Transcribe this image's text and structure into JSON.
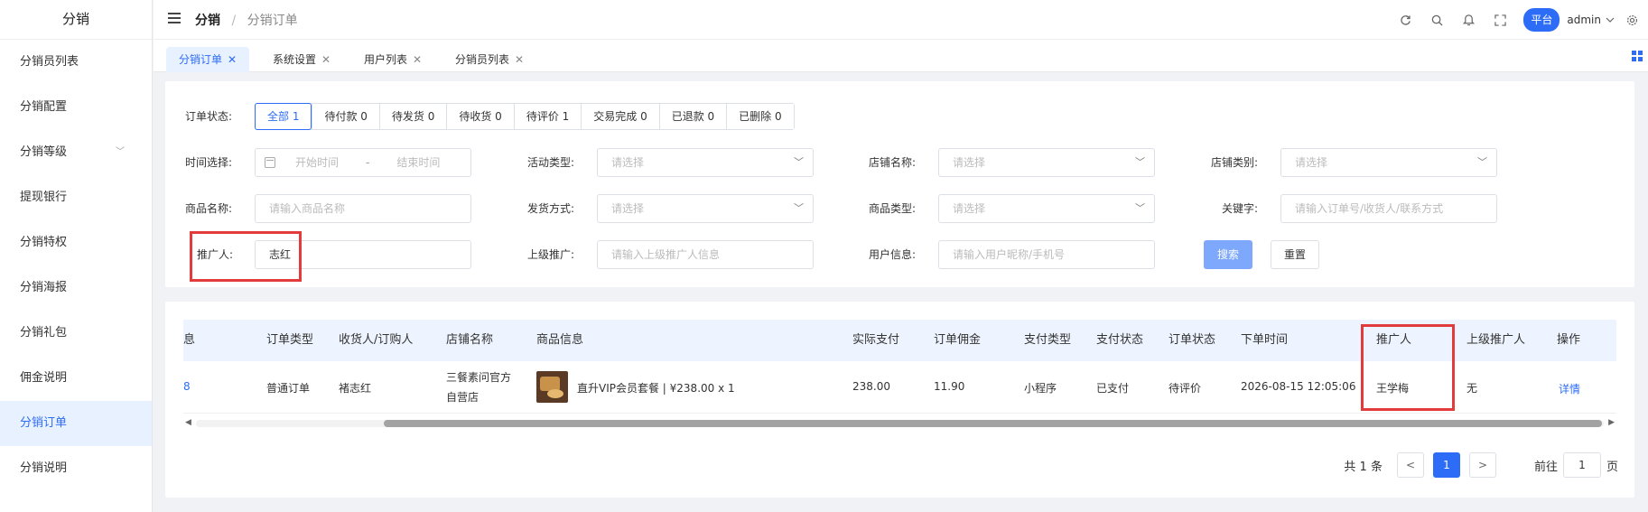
{
  "sidebar": {
    "title": "分销",
    "items": [
      {
        "label": "分销员列表"
      },
      {
        "label": "分销配置"
      },
      {
        "label": "分销等级"
      },
      {
        "label": "提现银行"
      },
      {
        "label": "分销特权"
      },
      {
        "label": "分销海报"
      },
      {
        "label": "分销礼包"
      },
      {
        "label": "佣金说明"
      },
      {
        "label": "分销订单"
      },
      {
        "label": "分销说明"
      }
    ],
    "active": "分销订单"
  },
  "header": {
    "breadcrumb_root": "分销",
    "breadcrumb_sep": "/",
    "breadcrumb_current": "分销订单",
    "platform_badge": "平台",
    "user": "admin",
    "icons": [
      "refresh-icon",
      "search-icon",
      "bell-icon",
      "fullscreen-icon",
      "chevron-down-icon",
      "settings-icon"
    ]
  },
  "tabs": [
    {
      "label": "分销订单",
      "active": true
    },
    {
      "label": "系统设置",
      "active": false
    },
    {
      "label": "用户列表",
      "active": false
    },
    {
      "label": "分销员列表",
      "active": false
    }
  ],
  "filters": {
    "order_status_label": "订单状态:",
    "statuses": [
      {
        "label": "全部 1"
      },
      {
        "label": "待付款 0"
      },
      {
        "label": "待发货 0"
      },
      {
        "label": "待收货 0"
      },
      {
        "label": "待评价 1"
      },
      {
        "label": "交易完成 0"
      },
      {
        "label": "已退款 0"
      },
      {
        "label": "已删除 0"
      }
    ],
    "time_label": "时间选择:",
    "time_start_placeholder": "开始时间",
    "time_sep": "-",
    "time_end_placeholder": "结束时间",
    "activity_label": "活动类型:",
    "activity_placeholder": "请选择",
    "shop_name_label": "店铺名称:",
    "shop_name_placeholder": "请选择",
    "shop_type_label": "店铺类别:",
    "shop_type_placeholder": "请选择",
    "product_name_label": "商品名称:",
    "product_name_placeholder": "请输入商品名称",
    "ship_label": "发货方式:",
    "ship_placeholder": "请选择",
    "product_type_label": "商品类型:",
    "product_type_placeholder": "请选择",
    "keyword_label": "关键字:",
    "keyword_placeholder": "请输入订单号/收货人/联系方式",
    "promoter_label": "推广人:",
    "promoter_value": "志红",
    "parent_label": "上级推广:",
    "parent_placeholder": "请输入上级推广人信息",
    "user_label": "用户信息:",
    "user_placeholder": "请输入用户昵称/手机号",
    "search_btn": "搜索",
    "reset_btn": "重置"
  },
  "table": {
    "columns": [
      "息",
      "订单类型",
      "收货人/订购人",
      "店铺名称",
      "商品信息",
      "实际支付",
      "订单佣金",
      "支付类型",
      "支付状态",
      "订单状态",
      "下单时间",
      "推广人",
      "上级推广人",
      "操作"
    ],
    "rows": [
      {
        "id_fragment": "8",
        "order_type": "普通订单",
        "receiver": "褚志红",
        "shop_line1": "三餐素问官方",
        "shop_line2": "自营店",
        "product": "直升VIP会员套餐 | ¥238.00 x 1",
        "paid": "238.00",
        "commission": "11.90",
        "pay_type": "小程序",
        "pay_status": "已支付",
        "order_status": "待评价",
        "order_time": "2026-08-15 12:05:06",
        "promoter": "王学梅",
        "parent_promoter": "无",
        "action": "详情"
      }
    ]
  },
  "pagination": {
    "total": "共 1 条",
    "current_page": "1",
    "goto_label": "前往",
    "goto_value": "1",
    "page_unit": "页"
  },
  "colors": {
    "accent": "#2d6cf6",
    "highlight": "#e23b3b"
  }
}
